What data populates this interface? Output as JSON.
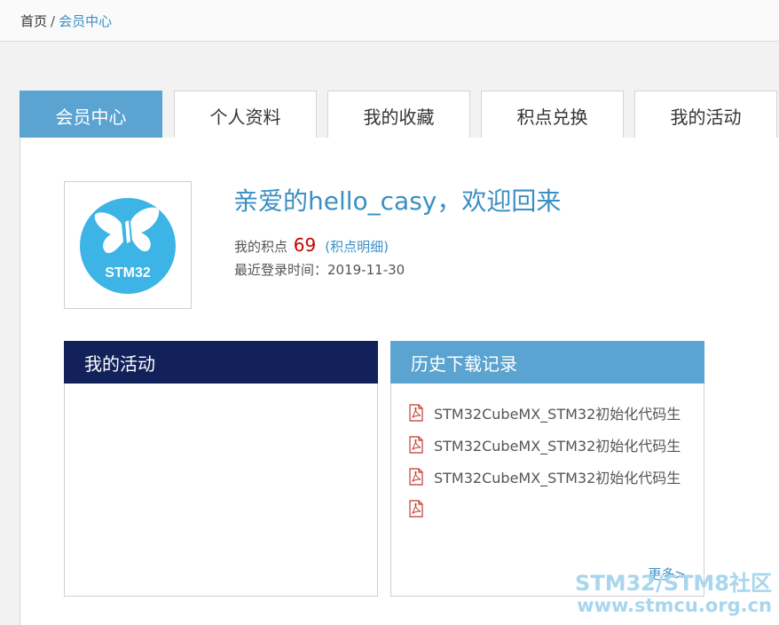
{
  "breadcrumb": {
    "home": "首页",
    "separator": "/",
    "current": "会员中心"
  },
  "tabs": [
    {
      "label": "会员中心",
      "active": true
    },
    {
      "label": "个人资料",
      "active": false
    },
    {
      "label": "我的收藏",
      "active": false
    },
    {
      "label": "积点兑换",
      "active": false
    },
    {
      "label": "我的活动",
      "active": false
    }
  ],
  "avatar": {
    "logo_text": "STM32",
    "logo_color": "#3cb4e5"
  },
  "welcome": "亲爱的hello_casy，欢迎回来",
  "points": {
    "label": "我的积点",
    "value": "69",
    "open": "(",
    "link": "积点明细",
    "close": ")"
  },
  "last_login": {
    "label": "最近登录时间：",
    "value": "2019-11-30"
  },
  "activities": {
    "title": "我的活动"
  },
  "history": {
    "title": "历史下载记录",
    "items": [
      {
        "icon": "pdf-icon",
        "text": "STM32CubeMX_STM32初始化代码生"
      },
      {
        "icon": "pdf-icon",
        "text": "STM32CubeMX_STM32初始化代码生"
      },
      {
        "icon": "pdf-icon",
        "text": "STM32CubeMX_STM32初始化代码生"
      },
      {
        "icon": "pdf-icon",
        "text": ""
      }
    ],
    "more": "更多>"
  },
  "watermark": {
    "line1": "STM32/STM8社区",
    "line2": "www.stmcu.org.cn"
  },
  "colors": {
    "accent": "#5ba3d0",
    "dark_header": "#13215a",
    "link": "#3a8fc4",
    "points": "#cc0000"
  }
}
